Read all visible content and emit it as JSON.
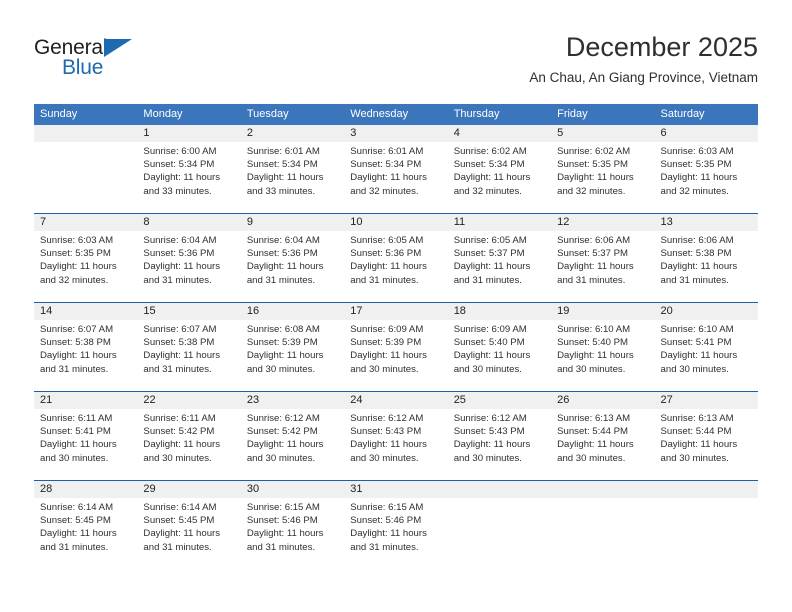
{
  "brand": {
    "name_dark": "General",
    "name_blue": "Blue",
    "accent_blue": "#1C6BB0"
  },
  "header": {
    "title": "December 2025",
    "subtitle": "An Chau, An Giang Province, Vietnam"
  },
  "colors": {
    "header_band": "#3B76BC",
    "row_separator": "#1F5FA8",
    "day_number_band": "#F0F0F0",
    "text": "#222222"
  },
  "calendar": {
    "weekdays": [
      "Sunday",
      "Monday",
      "Tuesday",
      "Wednesday",
      "Thursday",
      "Friday",
      "Saturday"
    ],
    "weeks": [
      {
        "numbers": [
          "",
          "1",
          "2",
          "3",
          "4",
          "5",
          "6"
        ],
        "cells": [
          {
            "lines": []
          },
          {
            "lines": [
              "Sunrise: 6:00 AM",
              "Sunset: 5:34 PM",
              "Daylight: 11 hours",
              "and 33 minutes."
            ]
          },
          {
            "lines": [
              "Sunrise: 6:01 AM",
              "Sunset: 5:34 PM",
              "Daylight: 11 hours",
              "and 33 minutes."
            ]
          },
          {
            "lines": [
              "Sunrise: 6:01 AM",
              "Sunset: 5:34 PM",
              "Daylight: 11 hours",
              "and 32 minutes."
            ]
          },
          {
            "lines": [
              "Sunrise: 6:02 AM",
              "Sunset: 5:34 PM",
              "Daylight: 11 hours",
              "and 32 minutes."
            ]
          },
          {
            "lines": [
              "Sunrise: 6:02 AM",
              "Sunset: 5:35 PM",
              "Daylight: 11 hours",
              "and 32 minutes."
            ]
          },
          {
            "lines": [
              "Sunrise: 6:03 AM",
              "Sunset: 5:35 PM",
              "Daylight: 11 hours",
              "and 32 minutes."
            ]
          }
        ]
      },
      {
        "numbers": [
          "7",
          "8",
          "9",
          "10",
          "11",
          "12",
          "13"
        ],
        "cells": [
          {
            "lines": [
              "Sunrise: 6:03 AM",
              "Sunset: 5:35 PM",
              "Daylight: 11 hours",
              "and 32 minutes."
            ]
          },
          {
            "lines": [
              "Sunrise: 6:04 AM",
              "Sunset: 5:36 PM",
              "Daylight: 11 hours",
              "and 31 minutes."
            ]
          },
          {
            "lines": [
              "Sunrise: 6:04 AM",
              "Sunset: 5:36 PM",
              "Daylight: 11 hours",
              "and 31 minutes."
            ]
          },
          {
            "lines": [
              "Sunrise: 6:05 AM",
              "Sunset: 5:36 PM",
              "Daylight: 11 hours",
              "and 31 minutes."
            ]
          },
          {
            "lines": [
              "Sunrise: 6:05 AM",
              "Sunset: 5:37 PM",
              "Daylight: 11 hours",
              "and 31 minutes."
            ]
          },
          {
            "lines": [
              "Sunrise: 6:06 AM",
              "Sunset: 5:37 PM",
              "Daylight: 11 hours",
              "and 31 minutes."
            ]
          },
          {
            "lines": [
              "Sunrise: 6:06 AM",
              "Sunset: 5:38 PM",
              "Daylight: 11 hours",
              "and 31 minutes."
            ]
          }
        ]
      },
      {
        "numbers": [
          "14",
          "15",
          "16",
          "17",
          "18",
          "19",
          "20"
        ],
        "cells": [
          {
            "lines": [
              "Sunrise: 6:07 AM",
              "Sunset: 5:38 PM",
              "Daylight: 11 hours",
              "and 31 minutes."
            ]
          },
          {
            "lines": [
              "Sunrise: 6:07 AM",
              "Sunset: 5:38 PM",
              "Daylight: 11 hours",
              "and 31 minutes."
            ]
          },
          {
            "lines": [
              "Sunrise: 6:08 AM",
              "Sunset: 5:39 PM",
              "Daylight: 11 hours",
              "and 30 minutes."
            ]
          },
          {
            "lines": [
              "Sunrise: 6:09 AM",
              "Sunset: 5:39 PM",
              "Daylight: 11 hours",
              "and 30 minutes."
            ]
          },
          {
            "lines": [
              "Sunrise: 6:09 AM",
              "Sunset: 5:40 PM",
              "Daylight: 11 hours",
              "and 30 minutes."
            ]
          },
          {
            "lines": [
              "Sunrise: 6:10 AM",
              "Sunset: 5:40 PM",
              "Daylight: 11 hours",
              "and 30 minutes."
            ]
          },
          {
            "lines": [
              "Sunrise: 6:10 AM",
              "Sunset: 5:41 PM",
              "Daylight: 11 hours",
              "and 30 minutes."
            ]
          }
        ]
      },
      {
        "numbers": [
          "21",
          "22",
          "23",
          "24",
          "25",
          "26",
          "27"
        ],
        "cells": [
          {
            "lines": [
              "Sunrise: 6:11 AM",
              "Sunset: 5:41 PM",
              "Daylight: 11 hours",
              "and 30 minutes."
            ]
          },
          {
            "lines": [
              "Sunrise: 6:11 AM",
              "Sunset: 5:42 PM",
              "Daylight: 11 hours",
              "and 30 minutes."
            ]
          },
          {
            "lines": [
              "Sunrise: 6:12 AM",
              "Sunset: 5:42 PM",
              "Daylight: 11 hours",
              "and 30 minutes."
            ]
          },
          {
            "lines": [
              "Sunrise: 6:12 AM",
              "Sunset: 5:43 PM",
              "Daylight: 11 hours",
              "and 30 minutes."
            ]
          },
          {
            "lines": [
              "Sunrise: 6:12 AM",
              "Sunset: 5:43 PM",
              "Daylight: 11 hours",
              "and 30 minutes."
            ]
          },
          {
            "lines": [
              "Sunrise: 6:13 AM",
              "Sunset: 5:44 PM",
              "Daylight: 11 hours",
              "and 30 minutes."
            ]
          },
          {
            "lines": [
              "Sunrise: 6:13 AM",
              "Sunset: 5:44 PM",
              "Daylight: 11 hours",
              "and 30 minutes."
            ]
          }
        ]
      },
      {
        "numbers": [
          "28",
          "29",
          "30",
          "31",
          "",
          "",
          ""
        ],
        "cells": [
          {
            "lines": [
              "Sunrise: 6:14 AM",
              "Sunset: 5:45 PM",
              "Daylight: 11 hours",
              "and 31 minutes."
            ]
          },
          {
            "lines": [
              "Sunrise: 6:14 AM",
              "Sunset: 5:45 PM",
              "Daylight: 11 hours",
              "and 31 minutes."
            ]
          },
          {
            "lines": [
              "Sunrise: 6:15 AM",
              "Sunset: 5:46 PM",
              "Daylight: 11 hours",
              "and 31 minutes."
            ]
          },
          {
            "lines": [
              "Sunrise: 6:15 AM",
              "Sunset: 5:46 PM",
              "Daylight: 11 hours",
              "and 31 minutes."
            ]
          },
          {
            "lines": []
          },
          {
            "lines": []
          },
          {
            "lines": []
          }
        ]
      }
    ]
  }
}
